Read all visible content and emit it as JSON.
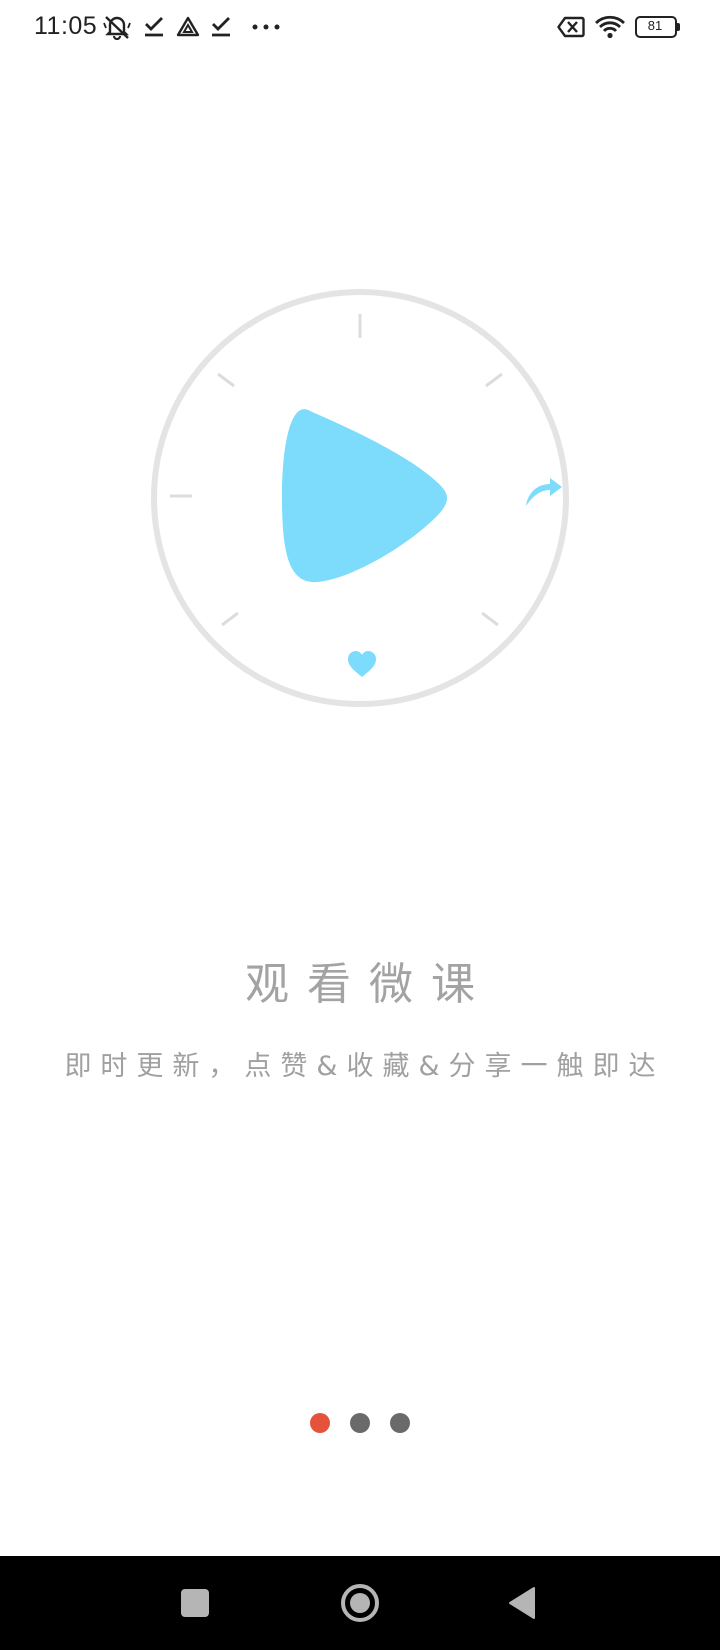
{
  "status_bar": {
    "time": "11:05",
    "icons": [
      "mute-icon",
      "check-icon",
      "drive-icon",
      "check-icon",
      "more-icon",
      "sim-off-icon",
      "wifi-icon",
      "battery-icon"
    ],
    "battery_level": "81"
  },
  "illustration": {
    "icons": [
      "play-icon",
      "share-icon",
      "heart-icon"
    ],
    "accent_color": "#7ddcfb",
    "ring_color": "#e4e4e4"
  },
  "content": {
    "title": "观看微课",
    "subtitle": "即时更新，点赞&收藏&分享一触即达"
  },
  "pager": {
    "count": 3,
    "active_index": 0,
    "active_color": "#e5533c",
    "inactive_color": "#6a6a6a"
  },
  "nav_bar": {
    "icons": [
      "recents-square-icon",
      "home-circle-icon",
      "back-triangle-icon"
    ]
  }
}
